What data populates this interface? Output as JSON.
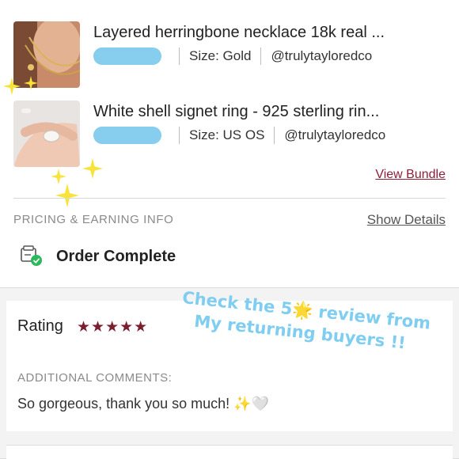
{
  "items": [
    {
      "title": "Layered herringbone necklace 18k real ...",
      "size": "Size: Gold",
      "seller": "@trulytayloredco"
    },
    {
      "title": "White shell signet ring - 925 sterling rin...",
      "size": "Size: US OS",
      "seller": "@trulytayloredco"
    }
  ],
  "view_bundle": "View Bundle",
  "pricing_label": "PRICING & EARNING INFO",
  "show_details": "Show Details",
  "order_status": "Order Complete",
  "rating": {
    "label": "Rating",
    "stars": "★★★★★",
    "value": 5
  },
  "comments": {
    "label": "ADDITIONAL COMMENTS:",
    "text": "So gorgeous, thank you so much! ✨🤍"
  },
  "overlay": {
    "line1_pre": "Check the 5",
    "line1_emoji": "🌟",
    "line1_post": " review from",
    "line2": "My returning buyers !!"
  },
  "colors": {
    "accent": "#8e1f3a",
    "stars": "#7a1f2e",
    "overlay_text": "#7fcdf0",
    "check_green": "#2eb85c"
  }
}
